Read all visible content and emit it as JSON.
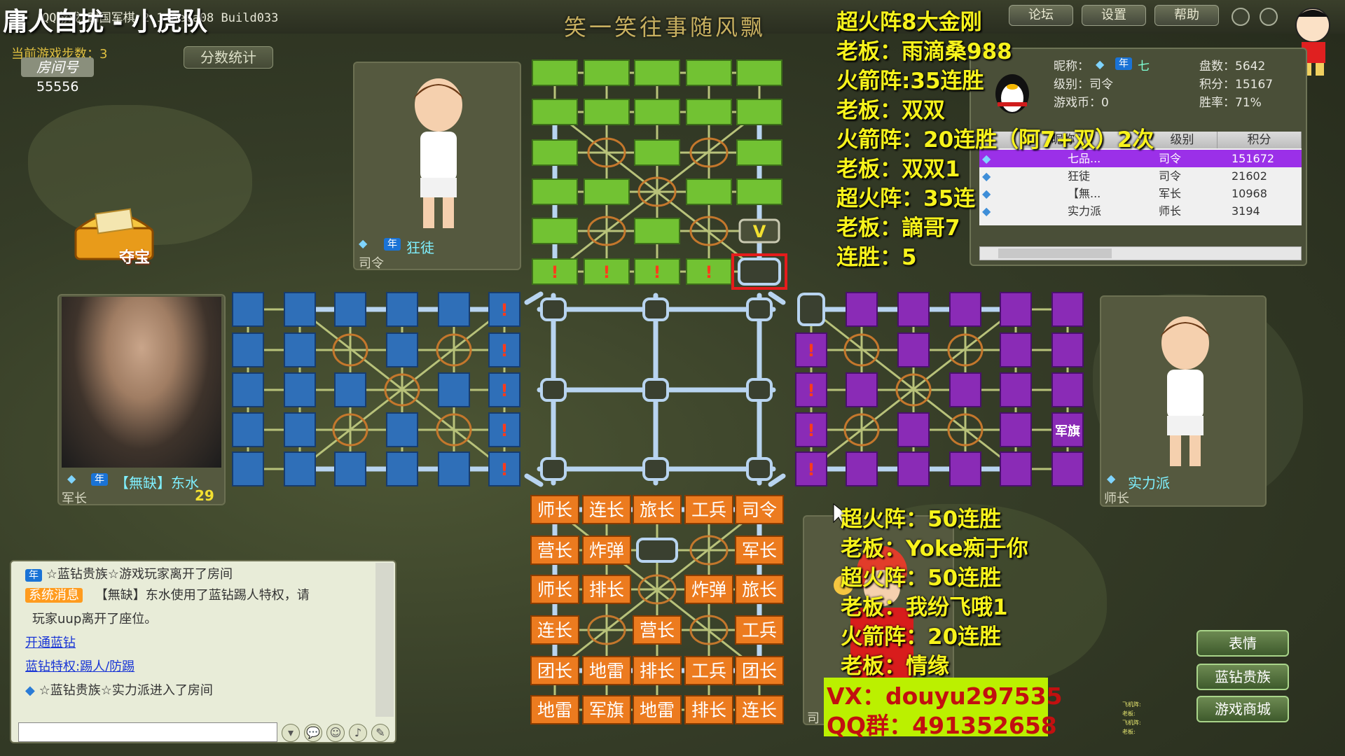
{
  "window": {
    "title": "QQ游戏 四国军棋 2.1 Beta08 Build033",
    "slogan": "笑一笑往事随风飘",
    "buttons": [
      "论坛",
      "设置",
      "帮助"
    ]
  },
  "stream": {
    "watermark": "庸人自扰 - 小虎队"
  },
  "game": {
    "step_label": "当前游戏步数：3",
    "score_button": "分数统计",
    "room_label": "房间号",
    "room_number": "55556",
    "treasure_label": "夺宝"
  },
  "players": {
    "top": {
      "name": "狂徒",
      "rank": "司令"
    },
    "left": {
      "name": "【無缺】东水",
      "rank": "军长",
      "count": "29"
    },
    "right": {
      "name": "实力派",
      "rank": "师长"
    },
    "bottom": {
      "rank": "司"
    }
  },
  "self_info": {
    "nick_label": "昵称：",
    "nick": "七",
    "level": "级别：司令",
    "coins": "游戏币：0",
    "games": "盘数：5642",
    "score": "积分：15167",
    "winrate": "胜率：71%"
  },
  "player_table": {
    "headers": [
      "昵称",
      "级别",
      "积分"
    ],
    "rows": [
      {
        "name": "七品...",
        "level": "司令",
        "score": "151672",
        "selected": true
      },
      {
        "name": "狂徒",
        "level": "司令",
        "score": "21602",
        "selected": false
      },
      {
        "name": "【無...",
        "level": "军长",
        "score": "10968",
        "selected": false
      },
      {
        "name": "实力派",
        "level": "师长",
        "score": "3194",
        "selected": false
      }
    ]
  },
  "overlay_top": [
    "超火阵8大金刚",
    "老板：雨滴桑988",
    "火箭阵:35连胜",
    "老板：双双",
    "火箭阵：20连胜（阿7+双）2次",
    "老板：双双1",
    "超火阵：35连",
    "老板：謫哥7",
    "连胜：5"
  ],
  "overlay_bottom": [
    "超火阵：50连胜",
    "老板：Yoke痴于你",
    "超火阵：50连胜",
    "老板：我纷飞哦1",
    "火箭阵：20连胜",
    "老板：情缘"
  ],
  "contact": {
    "vx": "VX：douyu297535",
    "qq": "QQ群：491352658"
  },
  "chat": {
    "lines": [
      "☆蓝钻贵族☆游戏玩家离开了房间",
      "【無缺】东水使用了蓝钻踢人特权，请",
      "玩家uup离开了座位。",
      "☆蓝钻贵族☆实力派进入了房间"
    ],
    "system_badge": "系统消息",
    "links": [
      "开通蓝钻",
      "蓝钻特权:踢人/防踢"
    ]
  },
  "side_buttons": [
    "表情",
    "蓝钻贵族",
    "游戏商城"
  ],
  "tiny_legend": [
    "飞机阵:",
    "老板:",
    "飞机阵:",
    "老板:"
  ],
  "board": {
    "top_alert": "!",
    "flag_mark": "V",
    "right_label": "军旗",
    "bottom_rows": [
      [
        "师长",
        "连长",
        "旅长",
        "工兵",
        "司令"
      ],
      [
        "营长",
        "炸弹",
        "",
        "",
        "军长"
      ],
      [
        "师长",
        "排长",
        "",
        "炸弹",
        "旅长"
      ],
      [
        "连长",
        "",
        "营长",
        "",
        "工兵"
      ],
      [
        "团长",
        "地雷",
        "排长",
        "工兵",
        "团长"
      ],
      [
        "地雷",
        "军旗",
        "地雷",
        "排长",
        "连长"
      ]
    ],
    "colors": {
      "top": "#72c233",
      "left": "#2f6fb8",
      "right": "#8a2bb6",
      "bottom": "#ec7b1f",
      "rail": "#b8d4f0",
      "camp": "#c4772c"
    }
  }
}
